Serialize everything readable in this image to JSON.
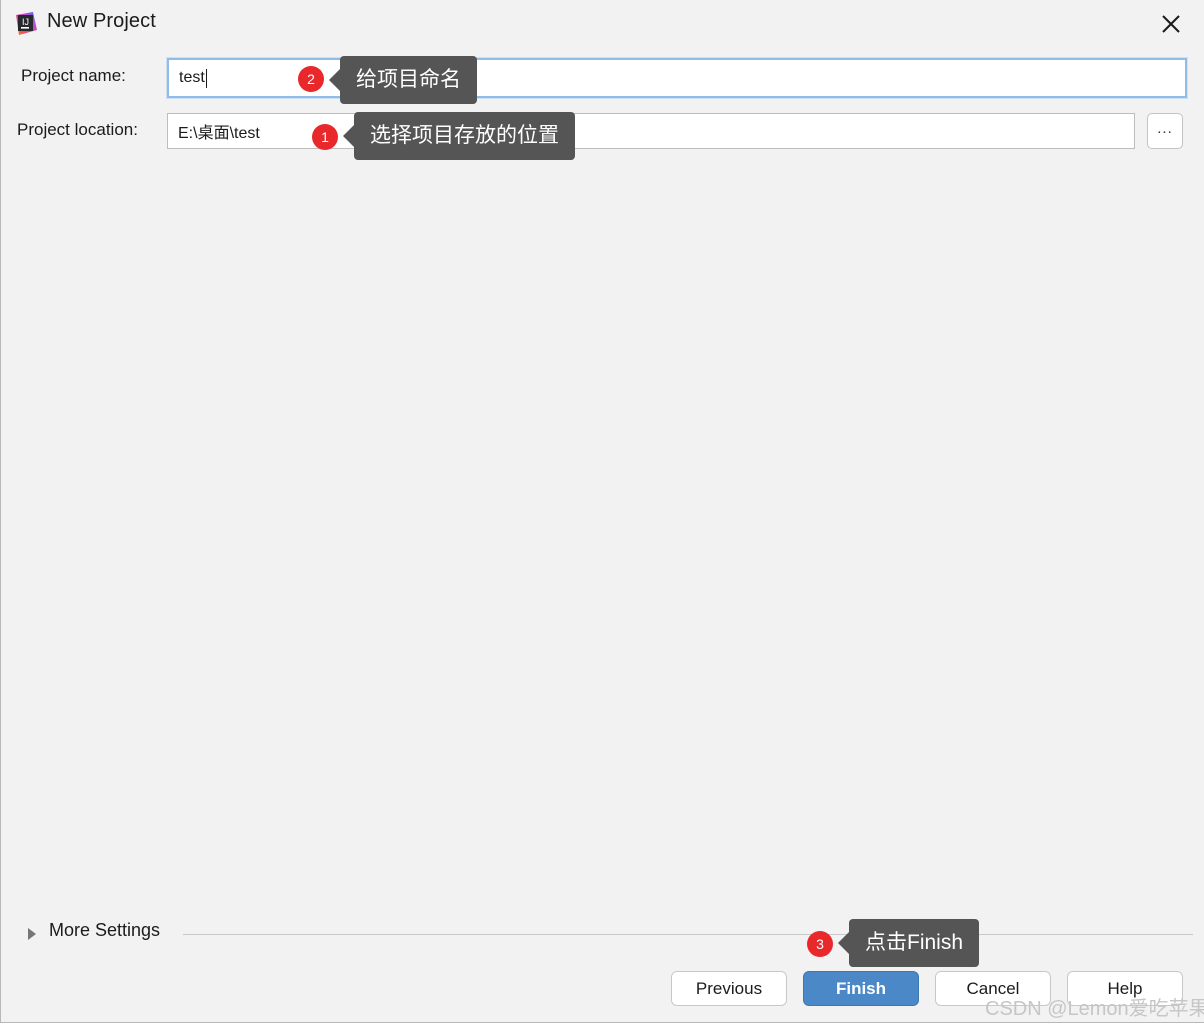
{
  "window": {
    "title": "New Project",
    "app_icon": "intellij-idea-icon",
    "close_icon": "close-icon",
    "background": "#f2f2f2"
  },
  "form": {
    "project_name": {
      "label": "Project name:",
      "value": "test",
      "placeholder": ""
    },
    "project_location": {
      "label": "Project location:",
      "value": "E:\\桌面\\test",
      "placeholder": "",
      "browse_label": "..."
    }
  },
  "more_settings": {
    "label": "More Settings",
    "expanded": false,
    "arrow_icon": "chevron-right-icon"
  },
  "buttons": {
    "previous": "Previous",
    "finish": "Finish",
    "cancel": "Cancel",
    "help": "Help"
  },
  "annotations": [
    {
      "number": "1",
      "text": "选择项目存放的位置"
    },
    {
      "number": "2",
      "text": "给项目命名"
    },
    {
      "number": "3",
      "text": "点击Finish"
    }
  ],
  "watermark": "CSDN @Lemon爱吃苹果",
  "colors": {
    "accent": "#4a88c7",
    "badge": "#e8282b",
    "tooltip": "#555555",
    "focus_ring": "#8fbce8"
  }
}
